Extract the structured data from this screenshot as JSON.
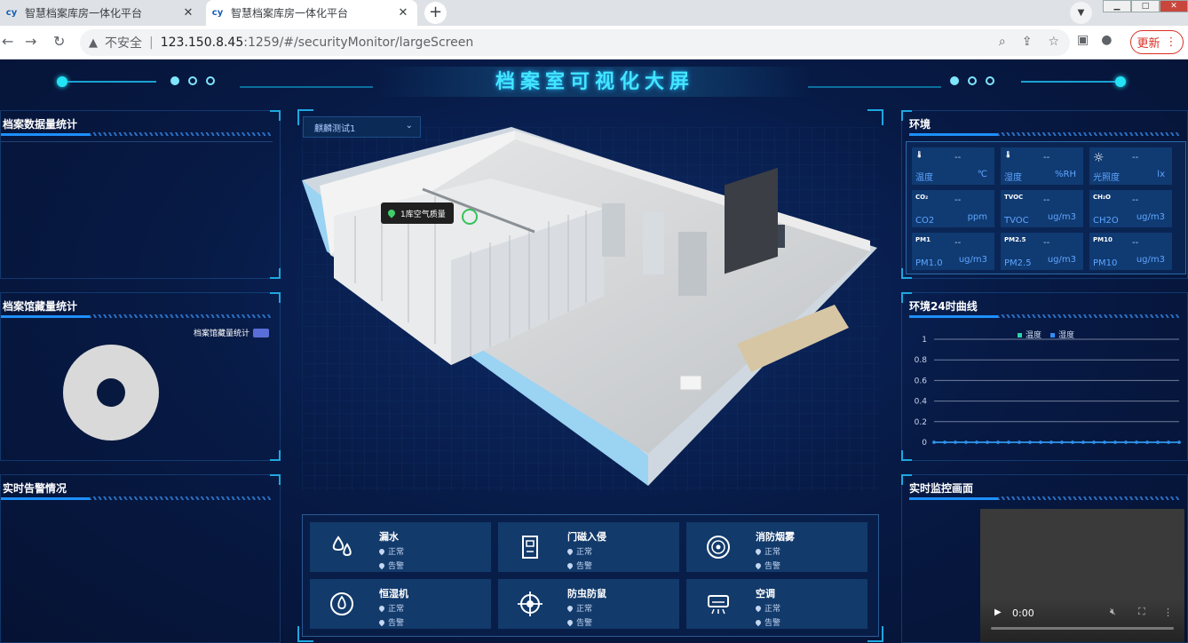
{
  "browser": {
    "tabs": [
      {
        "title": "智慧档案库房一体化平台",
        "favicon": "cy",
        "active": false
      },
      {
        "title": "智慧档案库房一体化平台",
        "favicon": "cy",
        "active": true
      }
    ],
    "address": {
      "security": "不安全",
      "host": "123.150.8.45",
      "path": ":1259/#/securityMonitor/largeScreen"
    },
    "update_label": "更新"
  },
  "screen": {
    "title": "档案室可视化大屏",
    "left": {
      "data_stats_title": "档案数据量统计",
      "holdings_title": "档案馆藏量统计",
      "holdings_legend": "档案馆藏量统计",
      "alarm_title": "实时告警情况"
    },
    "center": {
      "room_select": "麒麟测试1",
      "tooltip": "1库空气质量",
      "sensors": [
        {
          "name": "漏水",
          "icon": "water-drop-icon",
          "normal": "正常",
          "alarm": "告警"
        },
        {
          "name": "门磁入侵",
          "icon": "door-icon",
          "normal": "正常",
          "alarm": "告警"
        },
        {
          "name": "消防烟雾",
          "icon": "smoke-detector-icon",
          "normal": "正常",
          "alarm": "告警"
        },
        {
          "name": "恒湿机",
          "icon": "humidifier-icon",
          "normal": "正常",
          "alarm": "告警"
        },
        {
          "name": "防虫防鼠",
          "icon": "pest-target-icon",
          "normal": "正常",
          "alarm": "告警"
        },
        {
          "name": "空调",
          "icon": "air-conditioner-icon",
          "normal": "正常",
          "alarm": "告警"
        }
      ]
    },
    "right": {
      "env_title": "环境",
      "env_items": [
        {
          "label": "温度",
          "value": "--",
          "unit": "℃",
          "icon": "thermometer-icon"
        },
        {
          "label": "湿度",
          "value": "--",
          "unit": "%RH",
          "icon": "humidity-thermometer-icon"
        },
        {
          "label": "光照度",
          "value": "--",
          "unit": "lx",
          "icon": "sun-icon"
        },
        {
          "label": "CO2",
          "value": "--",
          "unit": "ppm",
          "icon": "co2-icon"
        },
        {
          "label": "TVOC",
          "value": "--",
          "unit": "ug/m3",
          "icon": "tvoc-icon"
        },
        {
          "label": "CH2O",
          "value": "--",
          "unit": "ug/m3",
          "icon": "ch2o-icon"
        },
        {
          "label": "PM1.0",
          "value": "--",
          "unit": "ug/m3",
          "icon": "pm1-icon"
        },
        {
          "label": "PM2.5",
          "value": "--",
          "unit": "ug/m3",
          "icon": "pm25-icon"
        },
        {
          "label": "PM10",
          "value": "--",
          "unit": "ug/m3",
          "icon": "pm10-icon"
        }
      ],
      "curve_title": "环境24时曲线",
      "monitor_title": "实时监控画面",
      "video_time": "0:00"
    }
  },
  "chart_data": {
    "type": "line",
    "legend": [
      "温度",
      "湿度"
    ],
    "y_ticks": [
      "1",
      "0.8",
      "0.6",
      "0.4",
      "0.2",
      "0"
    ],
    "ylim": [
      0,
      1
    ],
    "series": [
      {
        "name": "温度",
        "color": "#2ed3a7",
        "values": [
          0,
          0,
          0,
          0,
          0,
          0,
          0,
          0,
          0,
          0,
          0,
          0,
          0,
          0,
          0,
          0,
          0,
          0,
          0,
          0,
          0,
          0,
          0,
          0
        ]
      },
      {
        "name": "湿度",
        "color": "#2f8ef5",
        "values": [
          0,
          0,
          0,
          0,
          0,
          0,
          0,
          0,
          0,
          0,
          0,
          0,
          0,
          0,
          0,
          0,
          0,
          0,
          0,
          0,
          0,
          0,
          0,
          0
        ]
      }
    ]
  }
}
